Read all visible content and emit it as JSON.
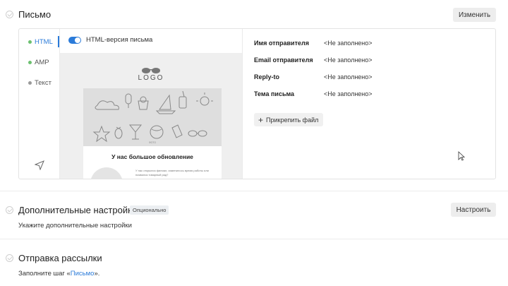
{
  "letter": {
    "title": "Письмо",
    "edit_button": "Изменить",
    "formats": [
      {
        "label": "HTML",
        "color": "#6cc070",
        "active": true
      },
      {
        "label": "AMP",
        "color": "#6cc070",
        "active": false
      },
      {
        "label": "Текст",
        "color": "#9a9a9a",
        "active": false
      }
    ],
    "html_toggle_label": "HTML-версия письма",
    "preview": {
      "logo_text": "LOGO",
      "hero_caption": "ФОТО",
      "heading": "У нас большое обновление",
      "body_text": "У нас открылся филиал, изменилось время работы или появился товарный ряд?"
    },
    "fields": [
      {
        "label": "Имя отправителя",
        "value": "<Не заполнено>"
      },
      {
        "label": "Email отправителя",
        "value": "<Не заполнено>"
      },
      {
        "label": "Reply-to",
        "value": "<Не заполнено>"
      },
      {
        "label": "Тема письма",
        "value": "<Не заполнено>"
      }
    ],
    "attach_button": "Прикрепить файл"
  },
  "extra": {
    "title": "Дополнительные настройки",
    "badge": "Опционально",
    "button": "Настроить",
    "description": "Укажите дополнительные настройки"
  },
  "send": {
    "title": "Отправка рассылки",
    "text_prefix": "Заполните шаг «",
    "link": "Письмо",
    "text_suffix": "»."
  }
}
